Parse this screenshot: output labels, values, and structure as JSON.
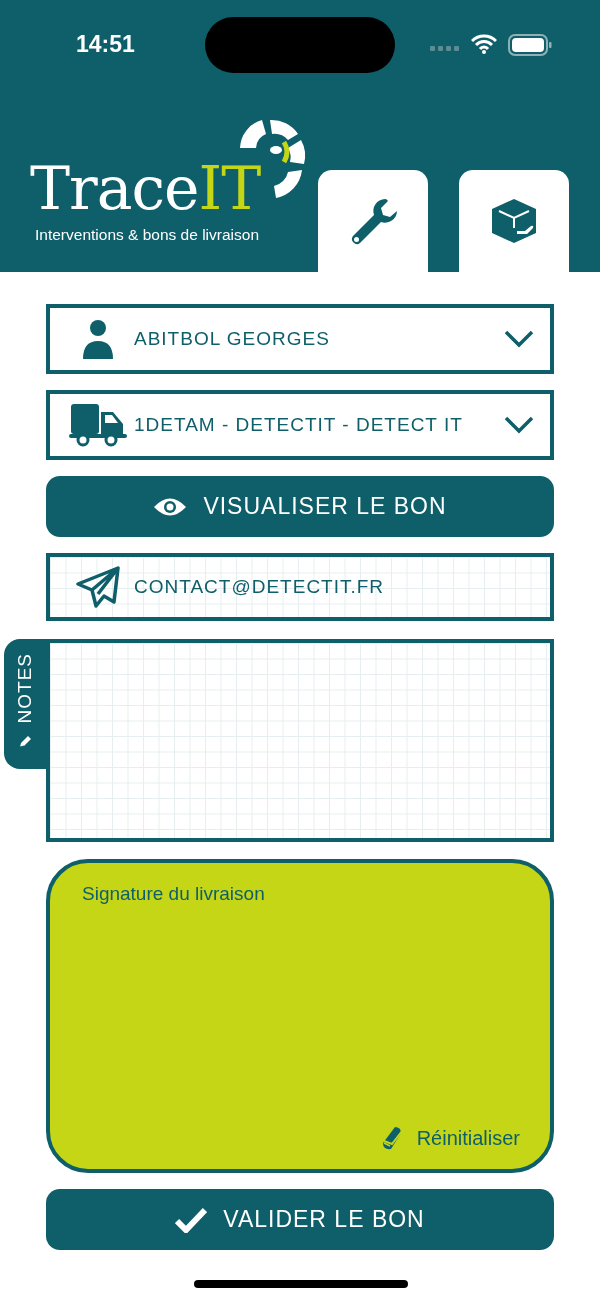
{
  "status_bar": {
    "time": "14:51"
  },
  "header": {
    "logo_word": "Trace",
    "logo_accent": "IT",
    "tagline": "Interventions & bons de livraison",
    "tabs": [
      {
        "kind": "wrench"
      },
      {
        "kind": "package"
      }
    ]
  },
  "selects": [
    {
      "kind": "person",
      "value": "ABITBOL GEORGES"
    },
    {
      "kind": "truck",
      "value": "1DETAM - DETECTIT - DETECT IT"
    }
  ],
  "view_button": "VISUALISER LE BON",
  "email": {
    "value": "CONTACT@DETECTIT.FR"
  },
  "notes": {
    "tab_label": "NOTES"
  },
  "signature": {
    "label": "Signature du livraison",
    "reset": "Réinitialiser"
  },
  "submit_button": "VALIDER LE BON"
}
